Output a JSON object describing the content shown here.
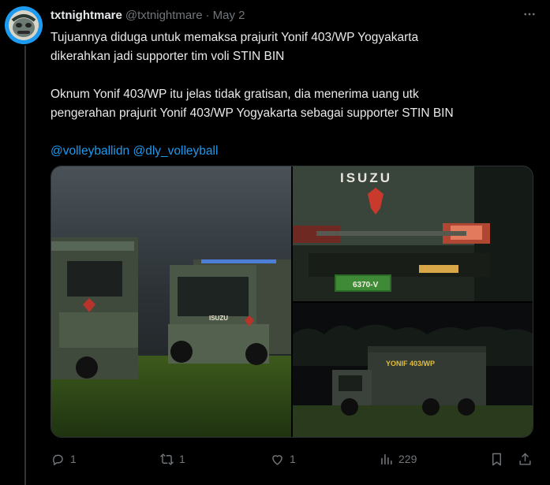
{
  "tweet": {
    "display_name": "txtnightmare",
    "handle": "@txtnightmare",
    "separator": "·",
    "date": "May 2",
    "text_lines": [
      "Tujuannya diduga untuk memaksa prajurit Yonif 403/WP Yogyakarta",
      "dikerahkan jadi supporter tim voli STIN BIN",
      "Oknum Yonif 403/WP itu jelas tidak gratisan, dia menerima uang utk",
      "pengerahan prajurit Yonif 403/WP Yogyakarta sebagai supporter STIN BIN"
    ],
    "mentions": [
      "@volleyballidn",
      "@dly_volleyball"
    ],
    "photo_texts": {
      "truck_brand": "ISUZU",
      "truck_brand_small": "ISUZU",
      "plate": "6370-V",
      "truck_label": "YONIF 403/WP"
    }
  },
  "actions": {
    "reply_count": "1",
    "retweet_count": "1",
    "like_count": "1",
    "views_count": "229"
  },
  "colors": {
    "accent": "#1d9bf0",
    "muted": "#71767b",
    "text": "#e7e9ea",
    "background": "#000000"
  },
  "icons": [
    "avatar-image",
    "more-icon",
    "reply-icon",
    "retweet-icon",
    "like-icon",
    "views-icon",
    "bookmark-icon",
    "share-icon"
  ]
}
